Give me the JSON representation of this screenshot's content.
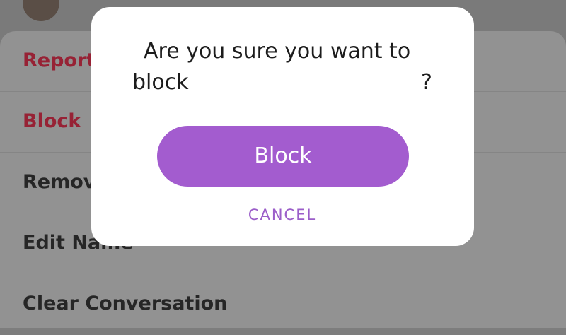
{
  "background_menu": {
    "items": [
      {
        "label": "Report",
        "style": "destructive"
      },
      {
        "label": "Block",
        "style": "destructive"
      },
      {
        "label": "Remov",
        "style": "normal"
      },
      {
        "label": "Edit Name",
        "style": "normal"
      },
      {
        "label": "Clear Conversation",
        "style": "normal"
      }
    ]
  },
  "dialog": {
    "message_line1": "Are you sure you want to",
    "message_line2": "block",
    "message_end": "?",
    "confirm_label": "Block",
    "cancel_label": "CANCEL"
  },
  "colors": {
    "accent": "#a35ccf",
    "destructive": "#972235",
    "dialog_bg": "#ffffff",
    "scrim": "#7d7d7d"
  }
}
